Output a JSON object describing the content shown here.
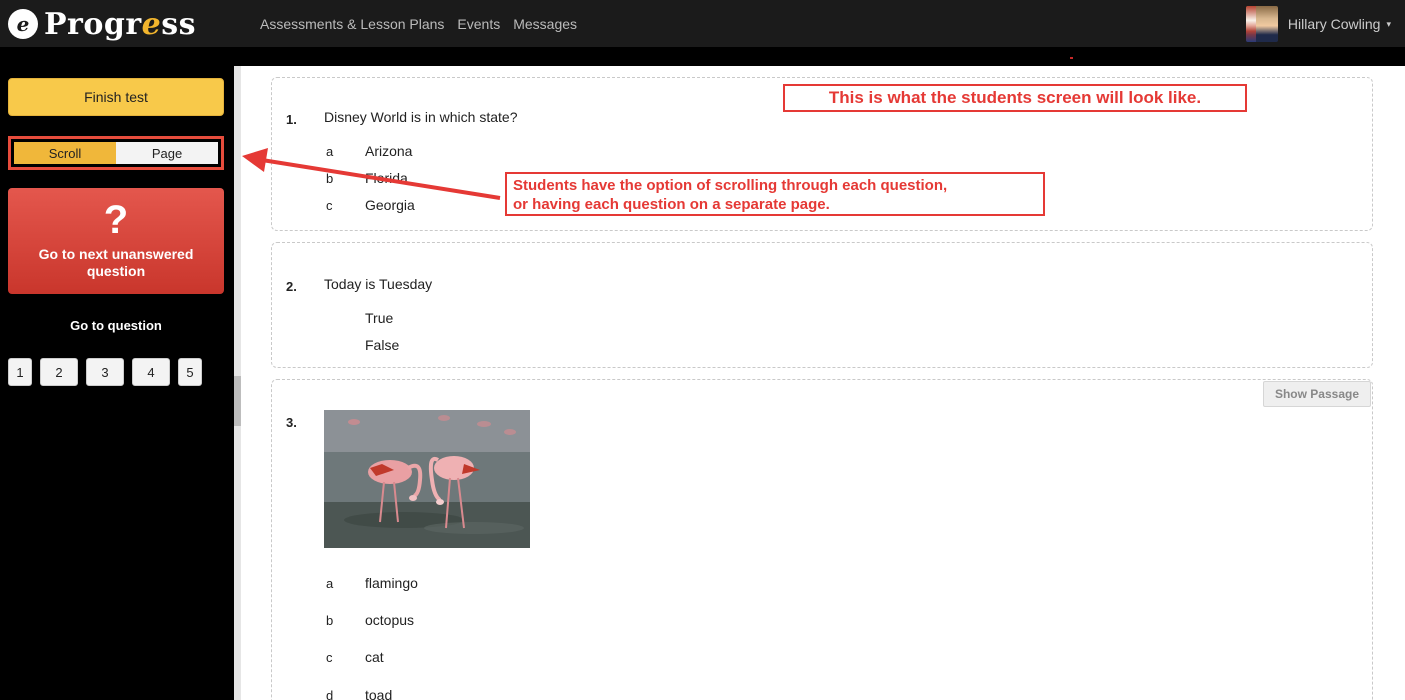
{
  "header": {
    "logo_mark": "e",
    "logo_text_pre": "Progr",
    "logo_text_e": "e",
    "logo_text_post": "ss",
    "nav": [
      "Assessments & Lesson Plans",
      "Events",
      "Messages"
    ],
    "user_name": "Hillary Cowling",
    "caret": "▾"
  },
  "sidebar": {
    "finish_label": "Finish test",
    "toggle": {
      "scroll": "Scroll",
      "page": "Page",
      "active": "Scroll"
    },
    "next_icon": "?",
    "next_label": "Go to next unanswered question",
    "goto_label": "Go to question",
    "question_numbers": [
      "1",
      "2",
      "3",
      "4",
      "5"
    ]
  },
  "questions": [
    {
      "number": "1.",
      "text": "Disney World is in which state?",
      "options": [
        {
          "letter": "a",
          "text": "Arizona"
        },
        {
          "letter": "b",
          "text": "Florida"
        },
        {
          "letter": "c",
          "text": "Georgia"
        }
      ]
    },
    {
      "number": "2.",
      "text": "Today is Tuesday",
      "options": [
        {
          "letter": "",
          "text": "True"
        },
        {
          "letter": "",
          "text": "False"
        }
      ]
    },
    {
      "number": "3.",
      "image": "flamingo-photo",
      "show_passage": "Show Passage",
      "options": [
        {
          "letter": "a",
          "text": "flamingo"
        },
        {
          "letter": "b",
          "text": "octopus"
        },
        {
          "letter": "c",
          "text": "cat"
        },
        {
          "letter": "d",
          "text": "toad"
        }
      ]
    }
  ],
  "annotations": {
    "top": "This is what the students screen will look like.",
    "mid_line1": "Students have the option of scrolling through each question,",
    "mid_line2": "or having each question on a separate page."
  },
  "colors": {
    "accent": "#f8c94a",
    "danger": "#d9463b",
    "annotation": "#e53935"
  }
}
